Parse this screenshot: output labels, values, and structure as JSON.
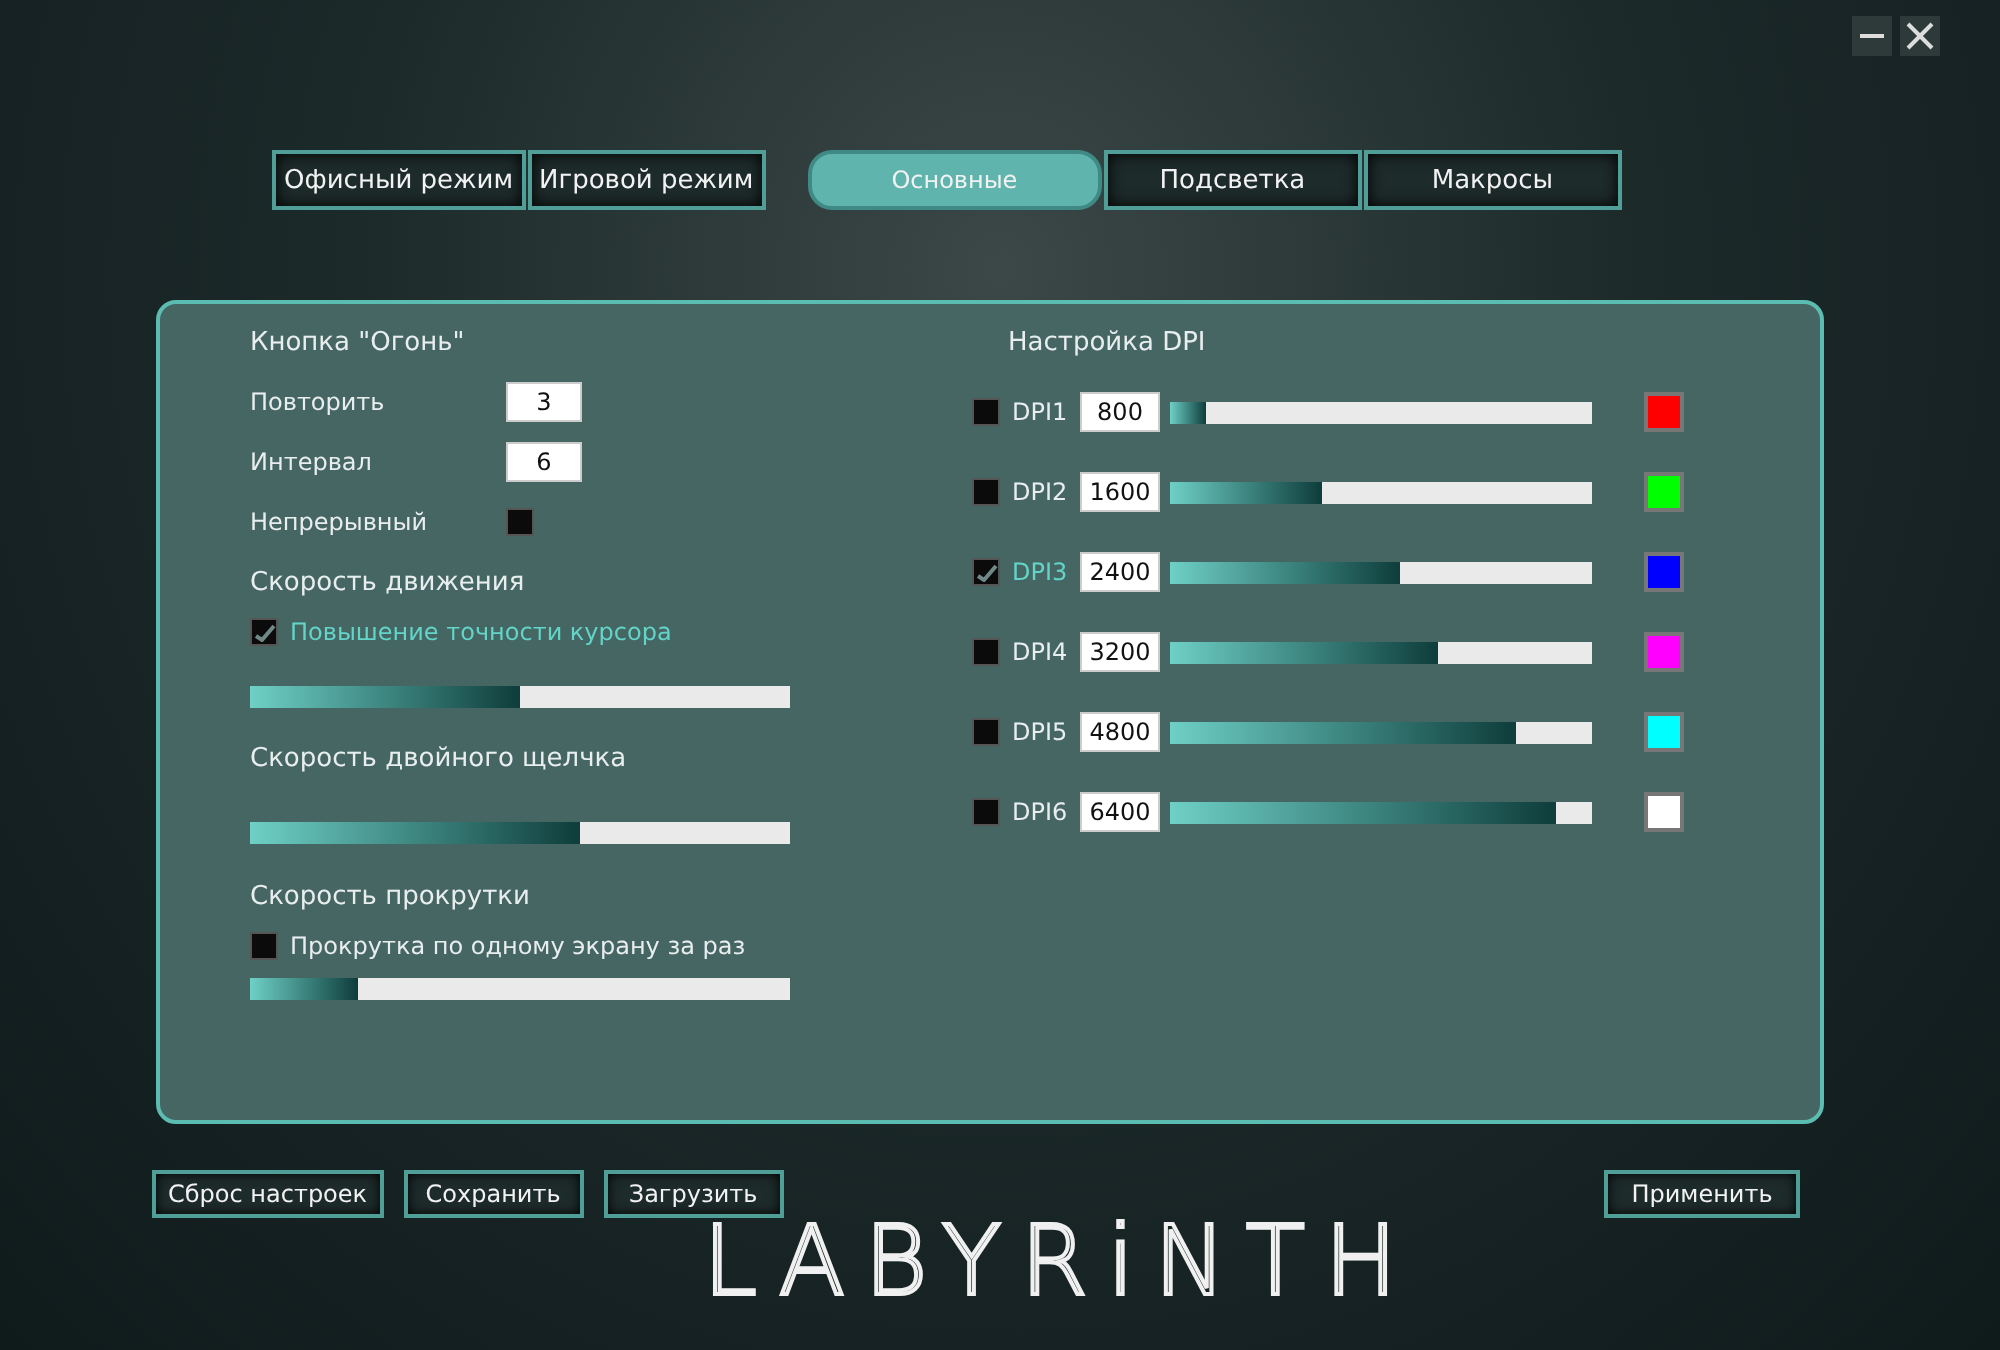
{
  "modes": [
    "Офисный режим",
    "Игровой режим"
  ],
  "tabs": [
    {
      "label": "Основные",
      "selected": true
    },
    {
      "label": "Подсветка",
      "selected": false
    },
    {
      "label": "Макросы",
      "selected": false
    }
  ],
  "fire_button": {
    "title": "Кнопка \"Огонь\"",
    "fields": [
      {
        "label": "Повторить",
        "value": "3"
      },
      {
        "label": "Интервал",
        "value": "6"
      }
    ],
    "continuous": {
      "label": "Непрерывный",
      "checked": false
    }
  },
  "motion_speed": {
    "title": "Скорость движения",
    "option": {
      "label": "Повышение точности курсора",
      "checked": true
    },
    "level": 0.5
  },
  "double_click_speed": {
    "title": "Скорость двойного щелчка",
    "level": 0.61
  },
  "scroll_speed": {
    "title": "Скорость прокрутки",
    "option": {
      "label": "Прокрутка по одному экрану за раз",
      "checked": false
    },
    "level": 0.2
  },
  "dpi": {
    "title": "Настройка DPI",
    "levels": [
      {
        "label": "DPI1",
        "value": "800",
        "checked": false,
        "level": 0.085,
        "color": "#ff0000"
      },
      {
        "label": "DPI2",
        "value": "1600",
        "checked": false,
        "level": 0.36,
        "color": "#00ff00"
      },
      {
        "label": "DPI3",
        "value": "2400",
        "checked": true,
        "level": 0.545,
        "color": "#0000ff"
      },
      {
        "label": "DPI4",
        "value": "3200",
        "checked": false,
        "level": 0.635,
        "color": "#ff00ff"
      },
      {
        "label": "DPI5",
        "value": "4800",
        "checked": false,
        "level": 0.82,
        "color": "#00ffff"
      },
      {
        "label": "DPI6",
        "value": "6400",
        "checked": false,
        "level": 0.915,
        "color": "#ffffff"
      }
    ]
  },
  "actions": [
    "Сброс настроек",
    "Сохранить",
    "Загрузить"
  ],
  "apply": "Применить",
  "logo": "LABYRiNTH"
}
